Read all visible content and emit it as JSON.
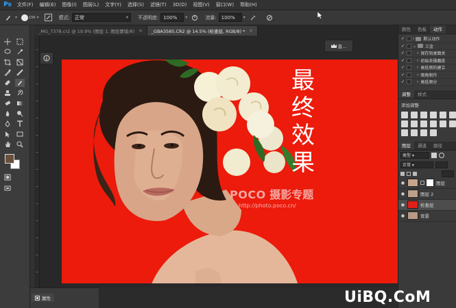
{
  "app": {
    "logo": "Ps"
  },
  "menu": [
    "文件(F)",
    "编辑(E)",
    "图像(I)",
    "图层(L)",
    "文字(Y)",
    "选择(S)",
    "滤镜(T)",
    "3D(D)",
    "视图(V)",
    "窗口(W)",
    "帮助(H)"
  ],
  "options": {
    "brush_size": "156",
    "mode_label": "模式:",
    "mode_value": "正常",
    "opacity_label": "不透明度:",
    "opacity_value": "100%",
    "flow_label": "流量:",
    "flow_value": "100%"
  },
  "tabs": [
    {
      "label": "_MG_7378.cr2 @ 19.9% (图层 1, 图层蒙版/8)",
      "active": false
    },
    {
      "label": "_GBA3585.CR2 @ 14.5% (检查层, RGB/8) *",
      "active": true
    }
  ],
  "mini_panel": {
    "label": "直..."
  },
  "canvas": {
    "title_chars": [
      "最",
      "终",
      "效",
      "果"
    ],
    "watermark_brand": "POCO",
    "watermark_name": "摄影专题",
    "watermark_url": "http://photo.poco.cn/",
    "colors": {
      "background": "#ec1b0c",
      "text": "#ffffff"
    }
  },
  "right_panel": {
    "top_tabs": [
      "颜色",
      "色板",
      "动作"
    ],
    "actions": [
      {
        "label": "默认动作",
        "checked": true,
        "expanded": false,
        "folder": true
      },
      {
        "label": "三金",
        "checked": true,
        "expanded": true,
        "folder": true
      },
      {
        "label": "保存到桌面关",
        "checked": true,
        "expanded": false,
        "folder": false
      },
      {
        "label": "初始去操磨皮",
        "checked": true,
        "expanded": false,
        "folder": false
      },
      {
        "label": "高低频的建立",
        "checked": true,
        "expanded": false,
        "folder": false
      },
      {
        "label": "暗角制作",
        "checked": true,
        "expanded": false,
        "folder": false
      },
      {
        "label": "高低频分",
        "checked": true,
        "expanded": false,
        "folder": false
      }
    ],
    "adj_tabs": [
      "调整",
      "样式"
    ],
    "adj_label": "添加调整",
    "layers_tabs": [
      "图层",
      "通道",
      "路径"
    ],
    "kind_label": "类型",
    "blend_value": "正常",
    "layers": [
      {
        "name": "图层",
        "thumb": "#c7a58a",
        "selected": false
      },
      {
        "name": "图层 2",
        "thumb": "#bda08a",
        "selected": false
      },
      {
        "name": "检查层",
        "thumb": "#e0201a",
        "selected": true
      },
      {
        "name": "背景",
        "thumb": "#b99a86",
        "selected": false
      }
    ]
  },
  "bottom": {
    "properties_label": "属性"
  },
  "site_watermark": "UiBQ.CoM"
}
